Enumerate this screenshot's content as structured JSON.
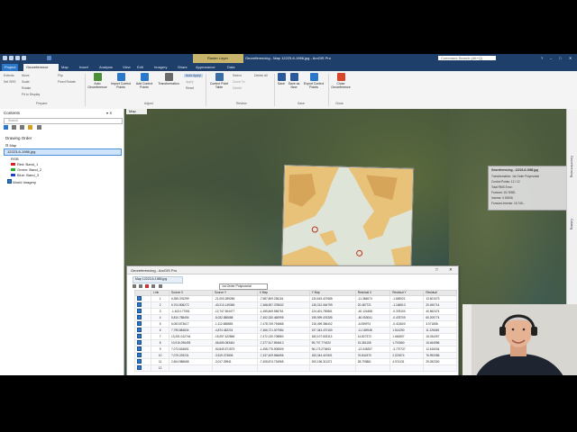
{
  "titlebar": {
    "context_tab": "Raster Layer",
    "title": "Georeferencing - Map 12223-6-1986.jpg - ArcGIS Pro",
    "search_placeholder": "Command Search (Alt+Q)",
    "user": "Michael (Esri Services Instruction)"
  },
  "tabs": [
    "Project",
    "Georeference",
    "Map",
    "Insert",
    "Analysis",
    "View",
    "Edit",
    "Imagery",
    "Share",
    "Appearance",
    "Data"
  ],
  "ribbon": {
    "prepare_items": [
      "Extents",
      "Set SRS",
      "Move",
      "Scale",
      "Rotate",
      "Fit to Display",
      "Flip",
      "Fixed Rotate"
    ],
    "buttons": [
      "Auto Georeference",
      "Import Control Points",
      "Add Control Points",
      "Transformation"
    ],
    "adjust_items": [
      "Auto Apply",
      "Apply",
      "Reset"
    ],
    "review_items": [
      "Control Point Table",
      "Select",
      "Zoom To",
      "Delete",
      "Delete All"
    ],
    "save_items": [
      "Save",
      "Save as New",
      "Export Control Points"
    ],
    "close_item": "Close Georeference",
    "groups": [
      "Prepare",
      "Adjust",
      "Review",
      "Save",
      "Close"
    ]
  },
  "contents": {
    "title": "Contents",
    "search_placeholder": "Search",
    "section": "Drawing Order",
    "map": "Map",
    "raster": "12223-6-1986.jpg",
    "rgb": "RGB",
    "bands": [
      {
        "label": "Red:  Band_1",
        "color": "#e02020"
      },
      {
        "label": "Green: Band_2",
        "color": "#20b020"
      },
      {
        "label": "Blue: Band_3",
        "color": "#2040d0"
      }
    ],
    "world": "World Imagery"
  },
  "map_tab": "Map",
  "infobox": {
    "title": "Georeferencing - 12223-6-1986.jpg",
    "lines": [
      "Transformation: 1st Order Polynomial",
      "Control Points: 12 / 12",
      "Total RMS Error:",
      "Forward: 15.74581",
      "Inverse: 0.00006",
      "Forward-Inverse: 15.745..."
    ]
  },
  "dialog": {
    "title": "Georeferencing - ArcGIS Pro",
    "tab": "Map 12223-6-1986.jpg",
    "transform": "1st Order Polynomial",
    "columns": [
      "",
      "Link",
      "Source X",
      "Source Y",
      "X Map",
      "Y Map",
      "Residual X",
      "Residual Y",
      "Residual"
    ],
    "rows": [
      [
        "1",
        "6,355.376299",
        "-21,000.289286",
        "-7,587,809.236116",
        "134,615.427685",
        "-11.384674",
        "-1.669021",
        "13.601073"
      ],
      [
        "2",
        "6,704.808272",
        "-40,210.149365",
        "-7,468,697.378632",
        "135,312.064799",
        "20.487721",
        "-1.166513",
        "20.490714"
      ],
      [
        "3",
        "-1,613.177051",
        "-12,747.504477",
        "-1,455,849.556761",
        "124,401.750861",
        "-40.124458",
        "-0.378100",
        "40.562474"
      ],
      [
        "4",
        "5,810.788494",
        "-5,032.880688",
        "-7,452,330.460995",
        "195,999.476285",
        "-60.053041",
        "-0.478709",
        "60.209774"
      ],
      [
        "5",
        "6,053.873617",
        "-1,112.588655",
        "-7,478,749.794868",
        "216,499.356402",
        "-6.059974",
        "-0.413600",
        "3.071856"
      ],
      [
        "6",
        "7,795.884834",
        "-4,874.482201",
        "-7,466,721.007984",
        "197,343.470150",
        "-11.169548",
        "1.514250",
        "11.226045"
      ],
      [
        "7",
        "13,251.012744",
        "-15,097.422866",
        "-7,472,130.708860",
        "183,107.503113",
        "14.827372",
        "1.046507",
        "15.034307"
      ],
      [
        "8",
        "10,916.296493",
        "-56,655.083461",
        "-7,377,517.894613",
        "95,707.774320",
        "15.381108",
        "1.791560",
        "15.464986"
      ],
      [
        "9",
        "7,073.634691",
        "-50,849.571579",
        "-1,498,776.905509",
        "96,173.270693",
        "-12.045257",
        "-3.770737",
        "12.616004"
      ],
      [
        "10",
        "7,075.225231",
        "-3,519.073606",
        "-7,437,409.566656",
        "183,344.447601",
        "76.844370",
        "2.223574",
        "76.992086"
      ],
      [
        "11",
        "2,604.986665",
        "-3,017.39941",
        "-7,408,874.734965",
        "200,196.311371",
        "28.793861",
        "4.074131",
        "29.052300"
      ],
      [
        "12",
        "",
        "",
        "",
        "",
        "",
        "",
        ""
      ]
    ]
  },
  "side_strip": [
    "Georeferencing",
    "Catalog"
  ]
}
